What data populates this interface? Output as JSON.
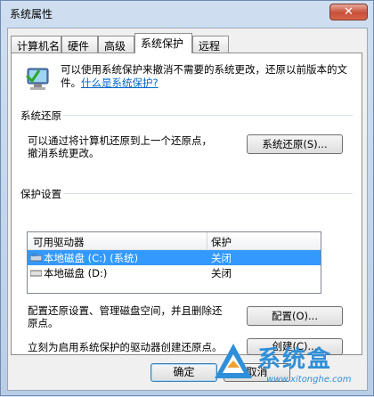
{
  "window": {
    "title": "系统属性",
    "close_label": "✕"
  },
  "tabs": [
    {
      "label": "计算机名"
    },
    {
      "label": "硬件"
    },
    {
      "label": "高级"
    },
    {
      "label": "系统保护",
      "active": true
    },
    {
      "label": "远程"
    }
  ],
  "intro": {
    "text": "可以使用系统保护来撤消不需要的系统更改，还原以前版本的文件。",
    "link": "什么是系统保护?"
  },
  "restore": {
    "group_title": "系统还原",
    "description_line1": "可以通过将计算机还原到上一个还原点，",
    "description_line2": "撤消系统更改。",
    "button_label": "系统还原(S)..."
  },
  "protection": {
    "group_title": "保护设置",
    "columns": [
      "可用驱动器",
      "保护"
    ],
    "drives": [
      {
        "name": "本地磁盘 (C:) (系统)",
        "status": "关闭",
        "selected": true
      },
      {
        "name": "本地磁盘 (D:)",
        "status": "关闭",
        "selected": false
      }
    ],
    "configure_text_line1": "配置还原设置、管理磁盘空间，并且删除还",
    "configure_text_line2": "原点。",
    "configure_button": "配置(O)...",
    "create_text": "立刻为启用系统保护的驱动器创建还原点。",
    "create_button": "创建(C)..."
  },
  "footer": {
    "ok_label": "确定",
    "cancel_label": "取消"
  },
  "watermark": {
    "title": "系统盒",
    "subtitle": "www.xitonghe.com"
  },
  "colors": {
    "selection": "#3399ff",
    "link": "#0066cc",
    "watermark": "#2f8fd8"
  }
}
